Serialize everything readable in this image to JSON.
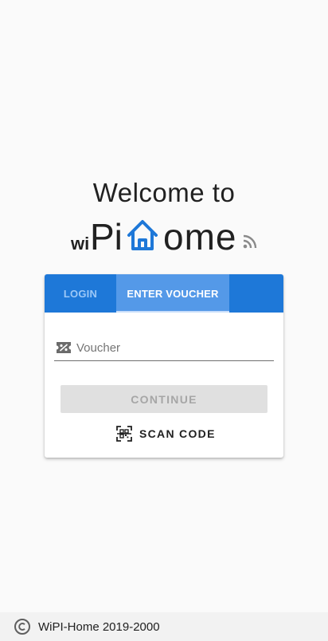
{
  "welcome": {
    "line1": "Welcome to",
    "logo_wi": "wi",
    "logo_pi": "Pi",
    "logo_ome": "ome",
    "logo_house_color": "#1e78d8",
    "logo_icons": [
      "house-icon",
      "rss-icon"
    ]
  },
  "tabs": {
    "items": [
      {
        "label": "LOGIN",
        "active": false
      },
      {
        "label": "ENTER VOUCHER",
        "active": true
      }
    ],
    "accent_color": "#1e78d8"
  },
  "voucher_form": {
    "input_placeholder": "Voucher",
    "input_value": "",
    "input_icon": "ticket-percent-icon",
    "continue_label": "CONTINUE",
    "continue_disabled": true,
    "scan_label": "SCAN CODE",
    "scan_icon": "qr-scan-icon"
  },
  "footer": {
    "icon": "copyright-icon",
    "text": "WiPI-Home 2019-2000"
  }
}
